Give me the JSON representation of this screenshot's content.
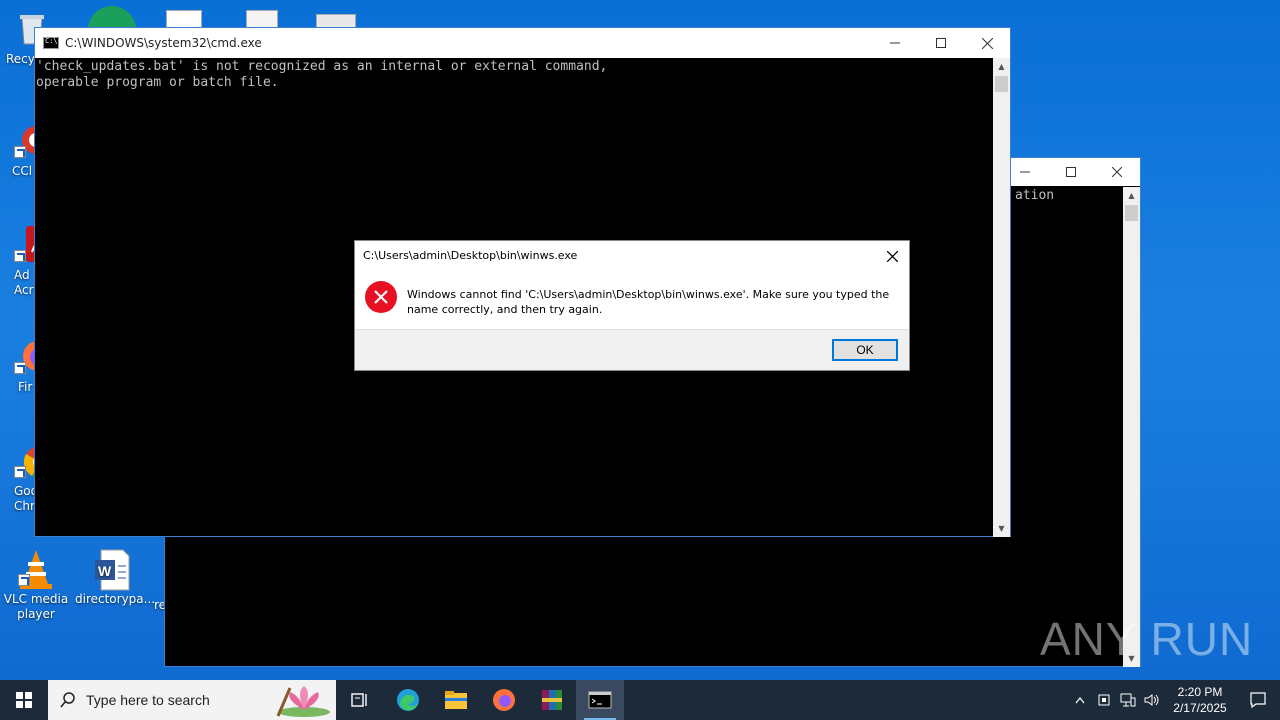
{
  "desktop": {
    "icons": [
      {
        "label": "Recy"
      },
      {
        "label": "CCl"
      },
      {
        "label": "Ad Acr"
      },
      {
        "label": "Fir"
      },
      {
        "label": "Goo Chr"
      },
      {
        "label": "VLC media player"
      },
      {
        "label": "directorypa..."
      },
      {
        "label": "re"
      }
    ]
  },
  "cmd_main": {
    "title": "C:\\WINDOWS\\system32\\cmd.exe",
    "lines": "'check_updates.bat' is not recognized as an internal or external command,\noperable program or batch file."
  },
  "cmd_back": {
    "visible_text": "ation"
  },
  "dialog": {
    "title": "C:\\Users\\admin\\Desktop\\bin\\winws.exe",
    "message": "Windows cannot find 'C:\\Users\\admin\\Desktop\\bin\\winws.exe'. Make sure you typed the name correctly, and then try again.",
    "ok_label": "OK",
    "icon": "error-icon"
  },
  "taskbar": {
    "search_placeholder": "Type here to search",
    "time": "2:20 PM",
    "date": "2/17/2025"
  },
  "watermark": "ANY RUN",
  "colors": {
    "accent": "#0078d7",
    "error": "#e81123",
    "taskbar": "#1c2a3a"
  }
}
